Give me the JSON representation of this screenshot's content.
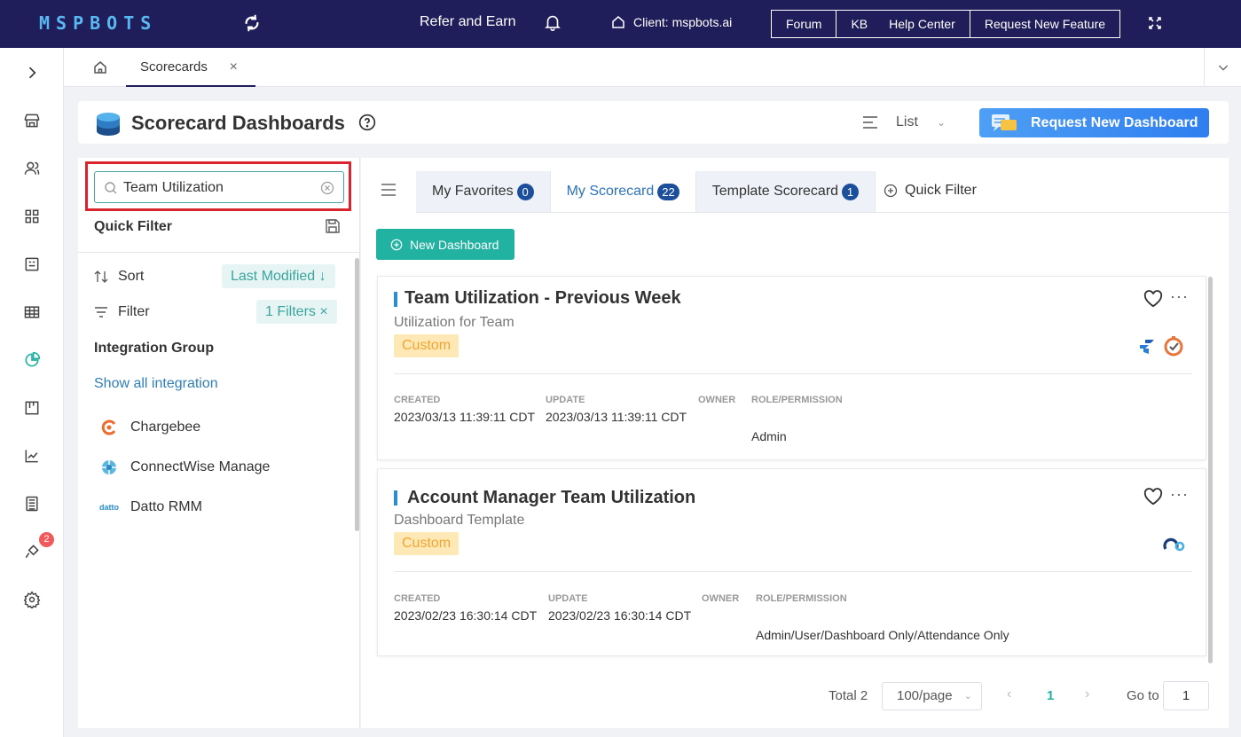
{
  "topbar": {
    "logo": "MSPBOTS",
    "refer": "Refer and Earn",
    "client": "Client: mspbots.ai",
    "links": [
      "Forum",
      "KB",
      "Help Center",
      "Request New Feature"
    ]
  },
  "sidebar": {
    "badge_count": "2"
  },
  "tabbar": {
    "active_tab": "Scorecards",
    "close": "×"
  },
  "header": {
    "title": "Scorecard Dashboards",
    "view_mode": "List",
    "request_button": "Request New Dashboard"
  },
  "left": {
    "search_value": "Team Utilization",
    "quick_filter_title": "Quick Filter",
    "sort_label": "Sort",
    "sort_value": "Last Modified ↓",
    "filter_label": "Filter",
    "filter_value": "1 Filters ×",
    "integration_group_title": "Integration Group",
    "show_all": "Show all integration",
    "integrations": [
      "Chargebee",
      "ConnectWise Manage",
      "Datto RMM"
    ],
    "datto_logo_text": "datto"
  },
  "main": {
    "tabs": [
      {
        "label": "My Favorites",
        "count": "0"
      },
      {
        "label": "My Scorecard",
        "count": "22"
      },
      {
        "label": "Template Scorecard",
        "count": "1"
      }
    ],
    "quick_filter": "Quick Filter",
    "new_dashboard": "New Dashboard",
    "cards": [
      {
        "title": "Team Utilization - Previous Week",
        "subtitle": "Utilization for Team",
        "badge": "Custom",
        "labels": {
          "created": "CREATED",
          "update": "UPDATE",
          "owner": "OWNER",
          "role": "ROLE/PERMISSION"
        },
        "created": "2023/03/13 11:39:11 CDT",
        "update": "2023/03/13 11:39:11 CDT",
        "owner": "",
        "role": "Admin"
      },
      {
        "title": "Account Manager Team Utilization",
        "subtitle": "Dashboard Template",
        "badge": "Custom",
        "labels": {
          "created": "CREATED",
          "update": "UPDATE",
          "owner": "OWNER",
          "role": "ROLE/PERMISSION"
        },
        "created": "2023/02/23 16:30:14 CDT",
        "update": "2023/02/23 16:30:14 CDT",
        "owner": "",
        "role": "Admin/User/Dashboard Only/Attendance Only"
      }
    ],
    "pagination": {
      "total": "Total 2",
      "page_size": "100/page",
      "current": "1",
      "goto_label": "Go to",
      "goto_value": "1"
    }
  },
  "colors": {
    "topbar": "#1f1d5a",
    "accent_teal": "#22b2a1",
    "accent_blue": "#2e72b8",
    "badge_navy": "#1b4e9b",
    "custom_badge_bg": "#fde8b6",
    "highlight_red": "#d9232d"
  },
  "icons": [
    "sync-icon",
    "bell-icon",
    "home-icon",
    "fullscreen-icon",
    "help-icon",
    "list-icon",
    "search-icon",
    "clear-icon",
    "save-icon",
    "sort-icon",
    "filter-icon",
    "heart-icon",
    "more-icon",
    "menu-icon",
    "plus-circle-icon",
    "chevron-right-icon",
    "store-icon",
    "users-icon",
    "grid-icon",
    "report-icon",
    "table-icon",
    "pie-chart-icon",
    "kanban-icon",
    "line-chart-icon",
    "calculator-icon",
    "plug-icon",
    "gear-icon"
  ]
}
